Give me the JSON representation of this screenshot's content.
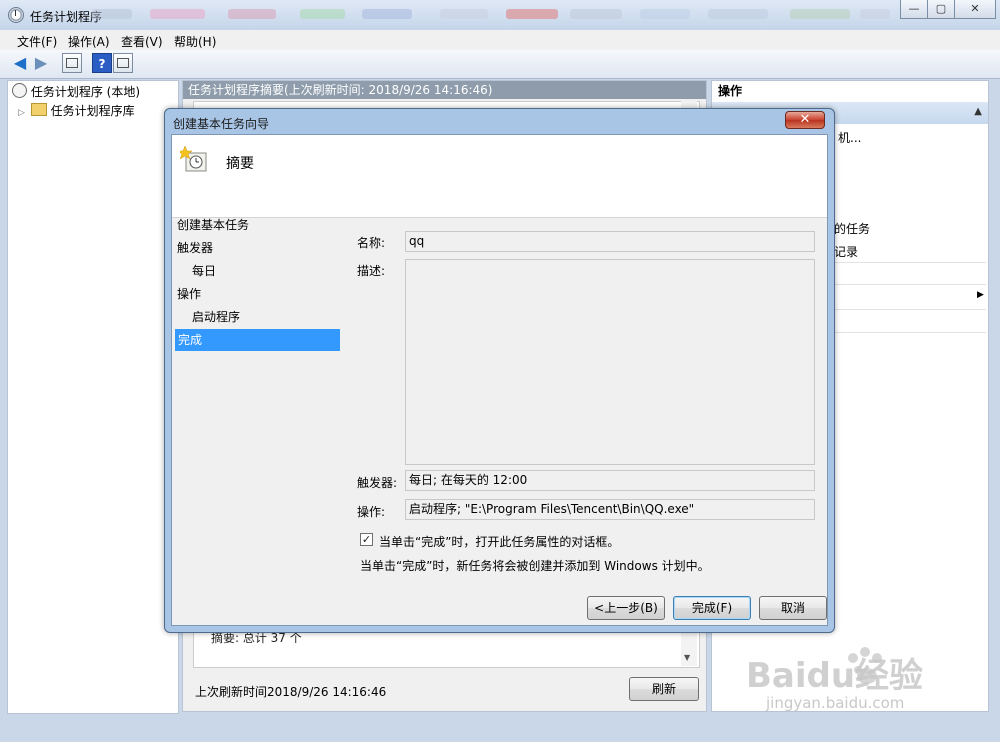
{
  "window": {
    "title": "任务计划程序",
    "controls": {
      "minimize": "—",
      "maximize": "▢",
      "close": "✕"
    }
  },
  "menu": [
    {
      "label": "文件(F)"
    },
    {
      "label": "操作(A)"
    },
    {
      "label": "查看(V)"
    },
    {
      "label": "帮助(H)"
    }
  ],
  "tree": {
    "root_label": "任务计划程序 (本地)",
    "child_label": "任务计划程序库"
  },
  "center": {
    "header": "任务计划程序摘要(上次刷新时间: 2018/9/26 14:16:46)",
    "summary_partial": "摘要: 总计 37 个",
    "last_refresh": "上次刷新时间2018/9/26 14:16:46",
    "refresh_button": "刷新"
  },
  "right_pane": {
    "header": "操作",
    "items_partial": [
      "机...",
      "的任务",
      "记录"
    ]
  },
  "dialog": {
    "title": "创建基本任务向导",
    "close": "✕",
    "heading": "摘要",
    "steps": [
      {
        "label": "创建基本任务"
      },
      {
        "label": "触发器"
      },
      {
        "label": "每日"
      },
      {
        "label": "操作"
      },
      {
        "label": "启动程序"
      },
      {
        "label": "完成"
      }
    ],
    "fields": {
      "name_label": "名称:",
      "name_value": "qq",
      "desc_label": "描述:",
      "desc_value": "",
      "trigger_label": "触发器:",
      "trigger_value": "每日; 在每天的 12:00",
      "action_label": "操作:",
      "action_value": "启动程序; \"E:\\Program Files\\Tencent\\Bin\\QQ.exe\""
    },
    "checkbox_label": "当单击“完成”时，打开此任务属性的对话框。",
    "checkbox_checked": true,
    "info_text": "当单击“完成”时，新任务将会被创建并添加到 Windows 计划中。",
    "buttons": {
      "back": "<上一步(B)",
      "finish": "完成(F)",
      "cancel": "取消"
    }
  },
  "watermark": {
    "brand": "Baidu经验",
    "url": "jingyan.baidu.com"
  }
}
